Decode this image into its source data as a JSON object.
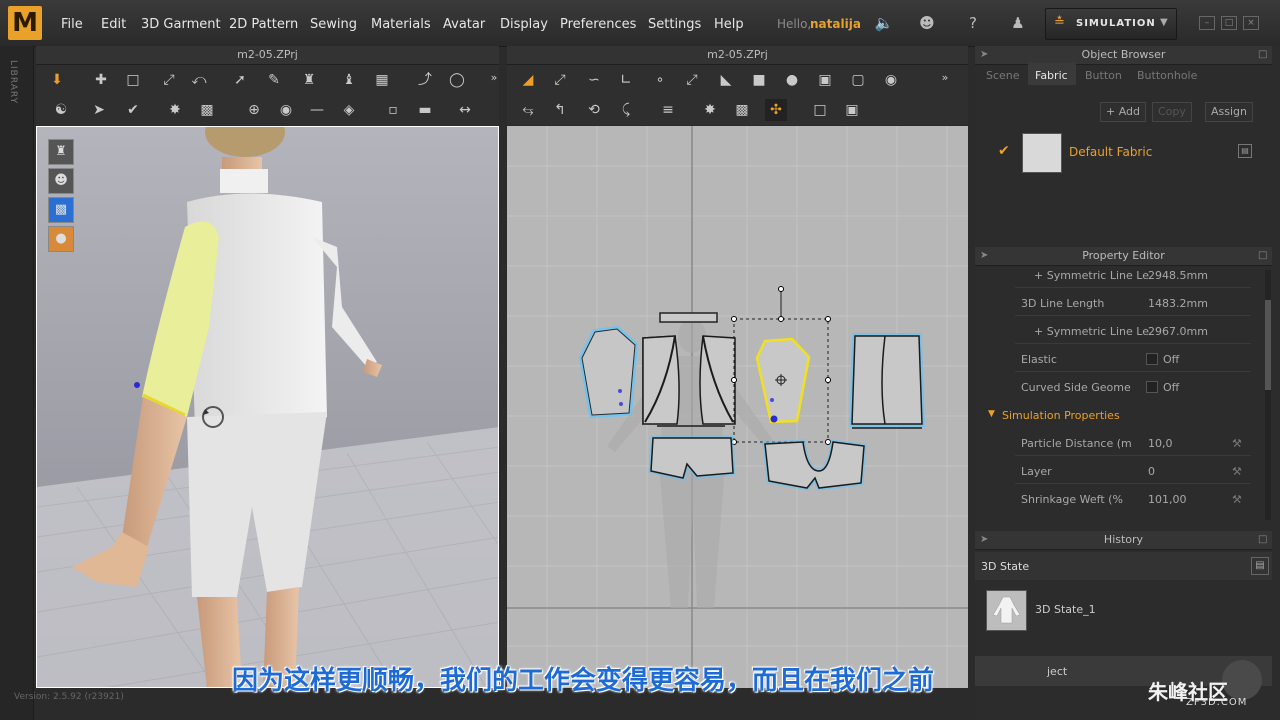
{
  "app": {
    "logo": "M",
    "hello": "Hello,",
    "user": "natalija",
    "simulation": "SIMULATION"
  },
  "menu": [
    "File",
    "Edit",
    "3D Garment",
    "2D Pattern",
    "Sewing",
    "Materials",
    "Avatar",
    "Display",
    "Preferences",
    "Settings",
    "Help"
  ],
  "library_label": "LIBRARY",
  "panel3d": {
    "title": "m2-05.ZPrj"
  },
  "panel2d": {
    "title": "m2-05.ZPrj"
  },
  "object_browser": {
    "title": "Object Browser",
    "tabs": [
      "Scene",
      "Fabric",
      "Button",
      "Buttonhole"
    ],
    "active_tab": "Fabric",
    "buttons": {
      "add": "+ Add",
      "copy": "Copy",
      "assign": "Assign"
    },
    "fabric": {
      "name": "Default Fabric",
      "accent": "#e9a12a"
    }
  },
  "property_editor": {
    "title": "Property Editor",
    "rows": [
      {
        "label": "+ Symmetric Line Le",
        "value": "2948.5mm"
      },
      {
        "label": "3D Line Length",
        "value": "1483.2mm"
      },
      {
        "label": "+ Symmetric Line Le",
        "value": "2967.0mm"
      },
      {
        "label": "Elastic",
        "value": "Off"
      },
      {
        "label": "Curved Side Geome",
        "value": "Off"
      }
    ],
    "section": "Simulation Properties",
    "sim_rows": [
      {
        "label": "Particle Distance (m",
        "value": "10,0"
      },
      {
        "label": "Layer",
        "value": "0"
      },
      {
        "label": "Shrinkage Weft (%",
        "value": "101,00"
      }
    ]
  },
  "history": {
    "title": "History",
    "state_label": "3D State",
    "item": "3D State_1",
    "partial": "ject"
  },
  "subtitle": "因为这样更顺畅，我们的工作会变得更容易，而且在我们之前",
  "watermark": {
    "main": "朱峰社区",
    "sub": "ZF3D.COM"
  },
  "status": "Version: 2.5.92    (r23921)",
  "colors": {
    "accent": "#e9a12a",
    "selection_blue": "#58c6ff",
    "selection_yellow": "#f0e020",
    "subtitle_blue": "#1e6bd6"
  }
}
